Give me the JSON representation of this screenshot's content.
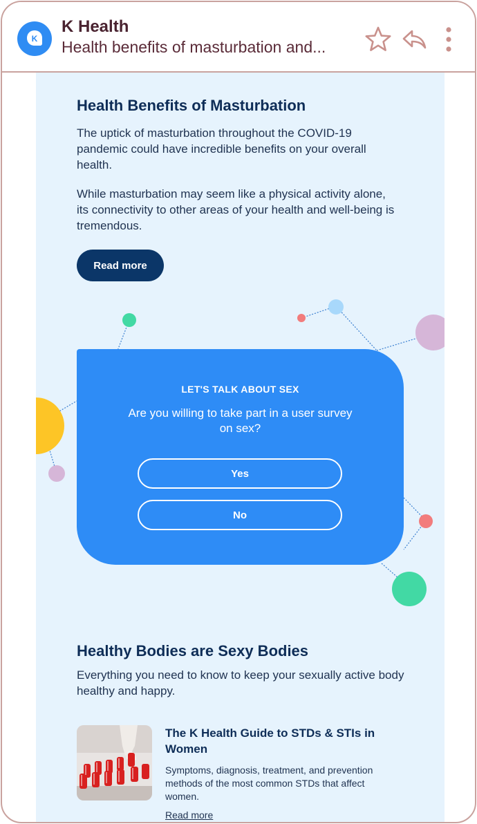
{
  "header": {
    "avatar_letter": "K",
    "sender": "K Health",
    "subject": "Health benefits of masturbation and..."
  },
  "article1": {
    "title": "Health Benefits of Masturbation",
    "para1": "The uptick of masturbation throughout the COVID-19 pandemic could have incredible benefits on your overall health.",
    "para2": "While masturbation may seem like a physical activity alone, its connectivity to other areas of your health and well-being is tremendous.",
    "button": "Read more"
  },
  "survey": {
    "kicker": "LET'S TALK ABOUT SEX",
    "question": "Are you willing to take part in a user survey on sex?",
    "yes": "Yes",
    "no": "No"
  },
  "section2": {
    "title": "Healthy Bodies are Sexy Bodies",
    "subtitle": "Everything you need to know to keep your sexually active body healthy and happy."
  },
  "article2": {
    "title": "The K Health Guide to STDs & STIs in Women",
    "description": "Symptoms, diagnosis, treatment, and prevention methods of the most common STDs  that affect women.",
    "link": "Read more"
  },
  "colors": {
    "brand": "#2f8cf3",
    "navy": "#0b3668",
    "background": "#e6f3fd",
    "frame": "#c9a29e"
  }
}
